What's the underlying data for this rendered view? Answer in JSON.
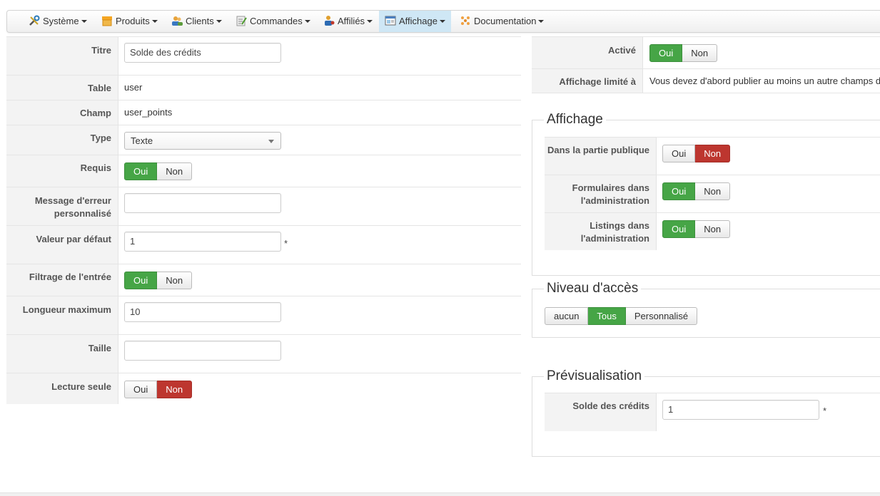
{
  "menu": [
    {
      "label": "Système",
      "icon": "tools-icon"
    },
    {
      "label": "Produits",
      "icon": "box-icon"
    },
    {
      "label": "Clients",
      "icon": "users-icon"
    },
    {
      "label": "Commandes",
      "icon": "order-icon"
    },
    {
      "label": "Affiliés",
      "icon": "affiliates-icon"
    },
    {
      "label": "Affichage",
      "icon": "display-icon",
      "active": true
    },
    {
      "label": "Documentation",
      "icon": "documentation-icon"
    }
  ],
  "form": {
    "titre": {
      "label": "Titre",
      "value": "Solde des crédits"
    },
    "table": {
      "label": "Table",
      "value": "user"
    },
    "champ": {
      "label": "Champ",
      "value": "user_points"
    },
    "type": {
      "label": "Type",
      "value": "Texte"
    },
    "requis": {
      "label": "Requis",
      "yes": "Oui",
      "no": "Non",
      "selected": "Oui"
    },
    "message": {
      "label": "Message d'erreur personnalisé",
      "value": ""
    },
    "defaut": {
      "label": "Valeur par défaut",
      "value": "1",
      "marker": "*"
    },
    "filtrage": {
      "label": "Filtrage de l'entrée",
      "yes": "Oui",
      "no": "Non",
      "selected": "Oui"
    },
    "longueur": {
      "label": "Longueur maximum",
      "value": "10"
    },
    "taille": {
      "label": "Taille",
      "value": ""
    },
    "lecture": {
      "label": "Lecture seule",
      "yes": "Oui",
      "no": "Non",
      "selected": "Non"
    }
  },
  "right": {
    "active": {
      "label": "Activé",
      "yes": "Oui",
      "no": "Non",
      "selected": "Oui"
    },
    "limit": {
      "label": "Affichage limité à",
      "value": "Vous devez d'abord publier au moins un autre champs de"
    },
    "display": {
      "legend": "Affichage",
      "public": {
        "label": "Dans la partie publique",
        "yes": "Oui",
        "no": "Non",
        "selected": "Non"
      },
      "forms": {
        "label": "Formulaires dans l'administration",
        "yes": "Oui",
        "no": "Non",
        "selected": "Oui"
      },
      "listings": {
        "label": "Listings dans l'administration",
        "yes": "Oui",
        "no": "Non",
        "selected": "Oui"
      }
    },
    "access": {
      "legend": "Niveau d'accès",
      "options": [
        "aucun",
        "Tous",
        "Personnalisé"
      ],
      "selected": "Tous"
    },
    "preview": {
      "legend": "Prévisualisation",
      "label": "Solde des crédits",
      "value": "1",
      "marker": "*"
    }
  },
  "colors": {
    "green": "#46a546",
    "red": "#bd362f",
    "menu_active": "#cfe7f5"
  }
}
